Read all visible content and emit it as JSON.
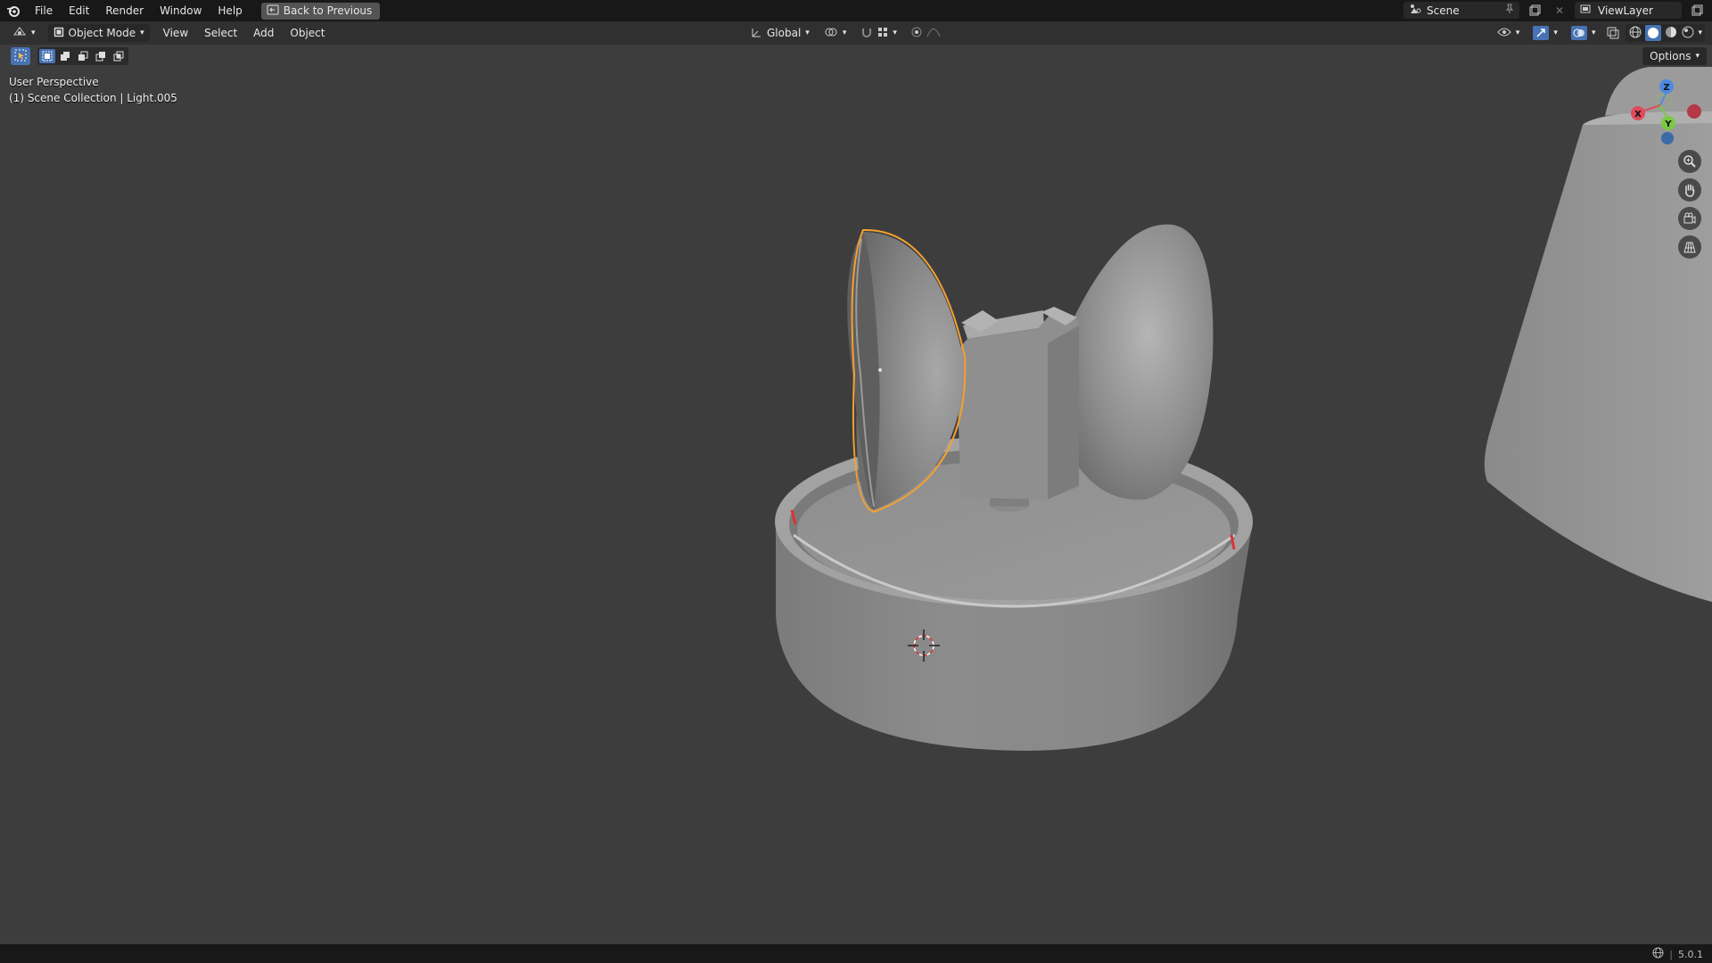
{
  "topbar": {
    "menus": [
      "File",
      "Edit",
      "Render",
      "Window",
      "Help"
    ],
    "back_label": "Back to Previous",
    "scene_name": "Scene",
    "view_layer": "ViewLayer"
  },
  "header": {
    "mode": "Object Mode",
    "menus": [
      "View",
      "Select",
      "Add",
      "Object"
    ],
    "orientation": "Global",
    "options_label": "Options"
  },
  "viewport": {
    "view_name": "User Perspective",
    "collection_info": "(1) Scene Collection | Light.005"
  },
  "gizmo": {
    "z": "Z",
    "x": "X",
    "y": "Y"
  },
  "status": {
    "version": "5.0.1"
  },
  "colors": {
    "viewport_bg": "#3d3d3d",
    "header_bg": "#303030",
    "topbar_bg": "#181818",
    "selection_outline": "#f5a030",
    "accent": "#4772b3"
  },
  "icons": [
    "blender-logo-icon",
    "back-icon",
    "scene-icon",
    "pin-icon",
    "new-scene-icon",
    "view-layer-icon",
    "editor-type-icon",
    "object-mode-icon",
    "transform-orientation-icon",
    "pivot-icon",
    "snap-icon",
    "proportional-edit-icon",
    "visibility-icon",
    "gizmo-icon",
    "overlay-icon",
    "xray-icon",
    "wireframe-shading-icon",
    "solid-shading-icon",
    "material-shading-icon",
    "rendered-shading-icon",
    "zoom-icon",
    "hand-pan-icon",
    "camera-view-icon",
    "grid-ortho-icon",
    "select-tool-icon",
    "3d-cursor-icon",
    "globe-icon"
  ]
}
